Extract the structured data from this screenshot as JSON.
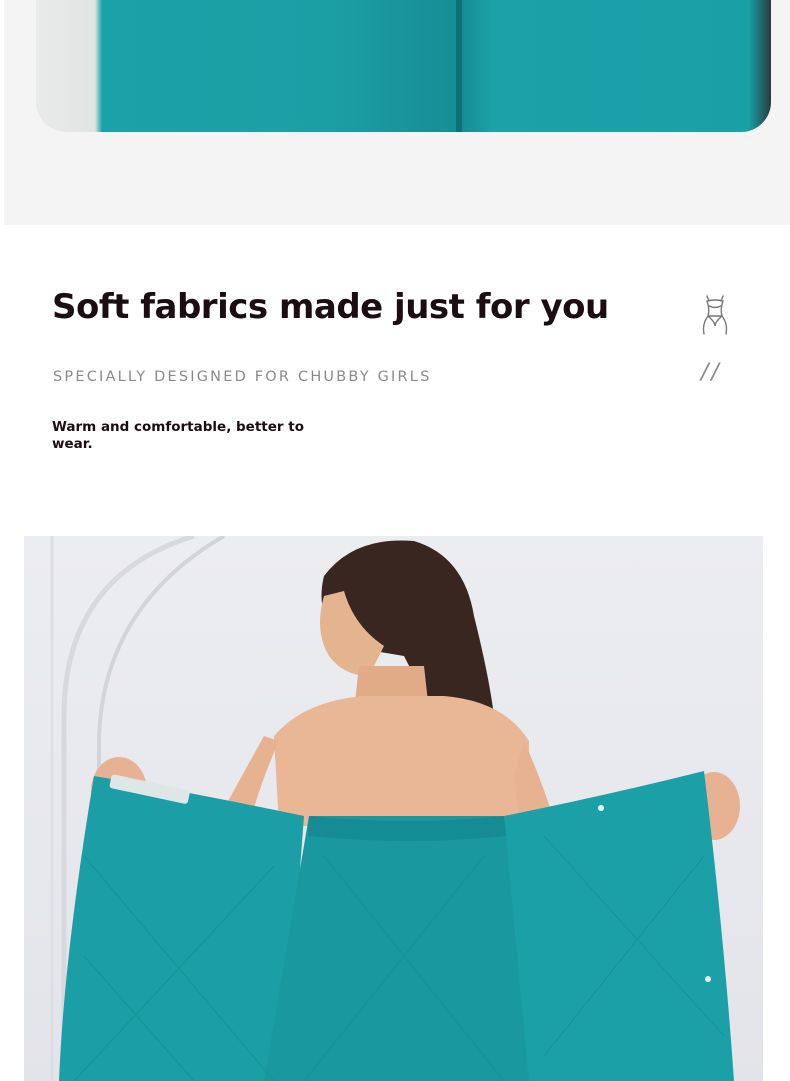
{
  "hero": {
    "headline": "Soft fabrics made just for you",
    "subheadline": "SPECIALLY DESIGNED FOR CHUBBY GIRLS",
    "description": "Warm and comfortable, better to wear.",
    "decoration": "//"
  },
  "icons": {
    "figure": "body-silhouette-icon"
  },
  "colors": {
    "accent": "#1b9ea5",
    "headline": "#1a0e12",
    "subheadline": "#8a8a8a",
    "band": "#f4f4f4"
  }
}
